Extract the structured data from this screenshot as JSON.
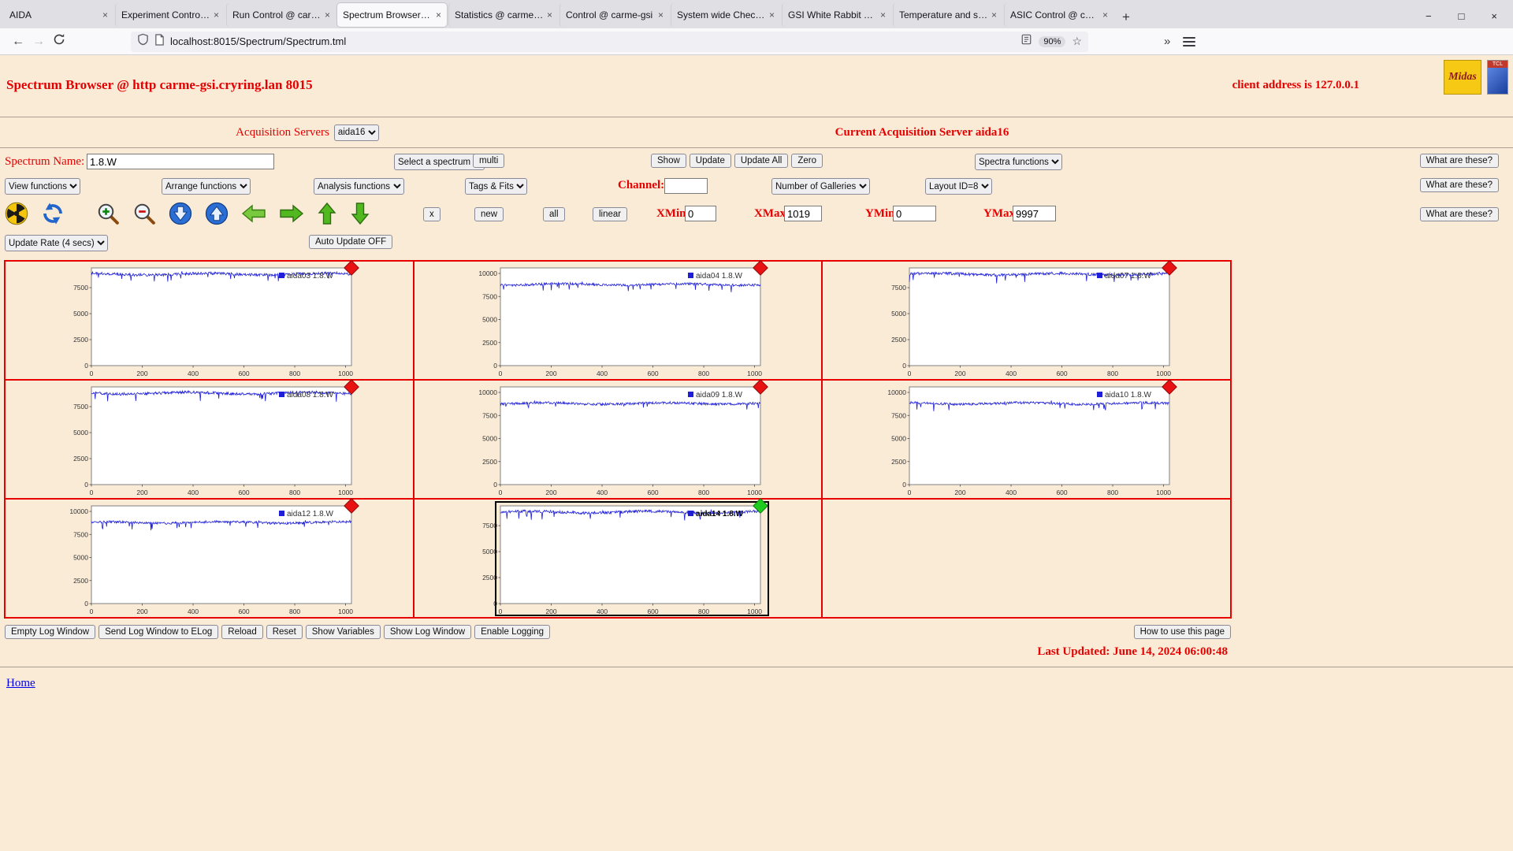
{
  "browser": {
    "tabs": [
      {
        "title": "AIDA",
        "active": false
      },
      {
        "title": "Experiment Control @ carme-gsi",
        "active": false
      },
      {
        "title": "Run Control @ carme-gsi",
        "active": false
      },
      {
        "title": "Spectrum Browser @ localhost",
        "active": true
      },
      {
        "title": "Statistics @ carme-gsi",
        "active": false
      },
      {
        "title": "Control @ carme-gsi",
        "active": false
      },
      {
        "title": "System wide Checks @ carme-gsi",
        "active": false
      },
      {
        "title": "GSI White Rabbit Timing",
        "active": false
      },
      {
        "title": "Temperature and status",
        "active": false
      },
      {
        "title": "ASIC Control @ carme-gsi",
        "active": false
      }
    ],
    "icons": {
      "back": "←",
      "forward": "→",
      "star": "☆",
      "overflow": "»",
      "new_tab": "+",
      "close": "×",
      "minimize": "−",
      "maximize": "□"
    },
    "nav": {
      "url": "localhost:8015/Spectrum/Spectrum.tml",
      "zoom": "90%"
    }
  },
  "header": {
    "title": "Spectrum Browser @ http carme-gsi.cryring.lan 8015",
    "client": "client address is 127.0.0.1",
    "logo_midas": "Midas",
    "logo_tcl": "TCL"
  },
  "server_row": {
    "label": "Acquisition Servers",
    "select_value": "aida16",
    "current": "Current Acquisition Server aida16"
  },
  "spectrum_row": {
    "label": "Spectrum Name:",
    "name_value": "1.8.W",
    "select_spectrum": "Select a spectrum",
    "multi": "multi",
    "actions": [
      "Show",
      "Update",
      "Update All",
      "Zero"
    ],
    "spectra_functions": "Spectra functions",
    "what": "What are these?"
  },
  "functions_row": {
    "selects": [
      "View functions",
      "Arrange functions",
      "Analysis functions",
      "Tags & Fits"
    ],
    "channel_label": "Channel:",
    "channel_value": "",
    "galleries": "Number of Galleries",
    "layout": "Layout ID=8",
    "what": "What are these?"
  },
  "toolbar_row": {
    "icons": [
      "radiation-icon",
      "refresh-icon",
      "zoom-in-icon",
      "zoom-out-icon",
      "sphere-down-icon",
      "sphere-up-icon",
      "arrow-left-icon",
      "arrow-right-icon",
      "arrow-up-icon",
      "arrow-down-icon"
    ],
    "buttons": [
      "x",
      "new",
      "all",
      "linear"
    ],
    "ranges": [
      {
        "label": "XMin",
        "value": "0"
      },
      {
        "label": "XMax",
        "value": "1019"
      },
      {
        "label": "YMin",
        "value": "0"
      },
      {
        "label": "YMax",
        "value": "9997"
      }
    ],
    "what": "What are these?"
  },
  "update_row": {
    "rate_select": "Update Rate (4 secs)",
    "auto_update": "Auto Update OFF"
  },
  "gallery": {
    "baseline": 8800,
    "xticks": [
      0,
      200,
      400,
      600,
      800,
      1000
    ],
    "xmax": 1023,
    "panels": [
      {
        "legend": "aida03 1.8.W",
        "marker": "red",
        "yticks": [
          0,
          2500,
          5000,
          7500
        ],
        "seed": 3,
        "selected": false
      },
      {
        "legend": "aida04 1.8.W",
        "marker": "red",
        "yticks": [
          0,
          2500,
          5000,
          7500,
          10000
        ],
        "seed": 4,
        "selected": false
      },
      {
        "legend": "aida07 1.8.W",
        "marker": "red",
        "yticks": [
          0,
          2500,
          5000,
          7500
        ],
        "seed": 7,
        "selected": false
      },
      {
        "legend": "aida08 1.8.W",
        "marker": "red",
        "yticks": [
          0,
          2500,
          5000,
          7500
        ],
        "seed": 8,
        "selected": false
      },
      {
        "legend": "aida09 1.8.W",
        "marker": "red",
        "yticks": [
          0,
          2500,
          5000,
          7500,
          10000
        ],
        "seed": 9,
        "selected": false
      },
      {
        "legend": "aida10 1.8.W",
        "marker": "red",
        "yticks": [
          0,
          2500,
          5000,
          7500,
          10000
        ],
        "seed": 10,
        "selected": false
      },
      {
        "legend": "aida12 1.8.W",
        "marker": "red",
        "yticks": [
          0,
          2500,
          5000,
          7500,
          10000
        ],
        "seed": 12,
        "selected": false
      },
      {
        "legend": "aida14 1.8.W",
        "marker": "green",
        "yticks": [
          0,
          2500,
          5000,
          7500
        ],
        "seed": 14,
        "selected": true
      },
      null
    ]
  },
  "footer": {
    "buttons": [
      "Empty Log Window",
      "Send Log Window to ELog",
      "Reload",
      "Reset",
      "Show Variables",
      "Show Log Window",
      "Enable Logging"
    ],
    "help": "How to use this page",
    "last_updated": "Last Updated: June 14, 2024 06:00:48",
    "home": "Home"
  }
}
